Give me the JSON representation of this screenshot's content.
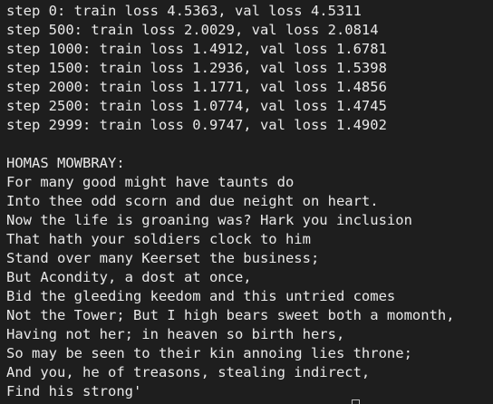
{
  "terminal": {
    "log_lines": [
      "step 0: train loss 4.5363, val loss 4.5311",
      "step 500: train loss 2.0029, val loss 2.0814",
      "step 1000: train loss 1.4912, val loss 1.6781",
      "step 1500: train loss 1.2936, val loss 1.5398",
      "step 2000: train loss 1.1771, val loss 1.4856",
      "step 2500: train loss 1.0774, val loss 1.4745",
      "step 2999: train loss 0.9747, val loss 1.4902"
    ],
    "generated_lines": [
      "HOMAS MOWBRAY:",
      "For many good might have taunts do",
      "Into thee odd scorn and due neight on heart.",
      "Now the life is groaning was? Hark you inclusion",
      "That hath your soldiers clock to him",
      "Stand over many Keerset the business;",
      "But Acondity, a dost at once,",
      "Bid the gleeding keedom and this untried comes",
      "Not the Tower; But I high bears sweet both a momonth,",
      "Having not her; in heaven so birth hers,",
      "So may be seen to their kin annoing lies throne;",
      "And you, he of treasons, stealing indirect,",
      "Find his strong'"
    ],
    "colors": {
      "background": "#1e1e1e",
      "text": "#e9e9e9"
    }
  }
}
